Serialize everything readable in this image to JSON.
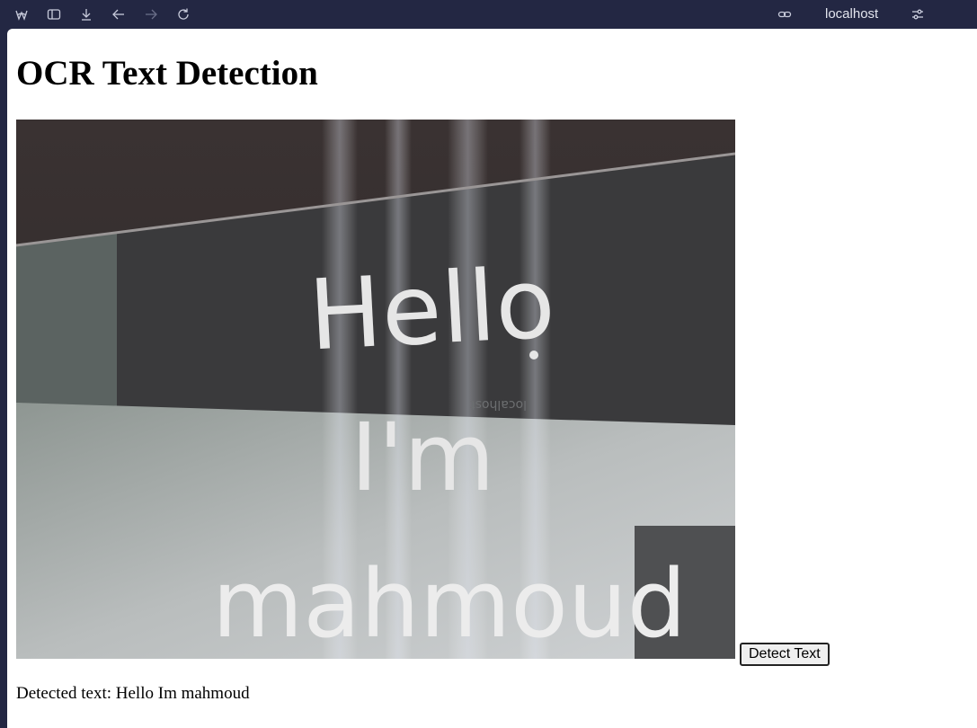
{
  "browser": {
    "url": "localhost",
    "icons": [
      "app-logo-icon",
      "sidebar-toggle-icon",
      "download-icon",
      "back-arrow-icon",
      "forward-arrow-icon",
      "reload-icon",
      "link-icon",
      "settings-sliders-icon"
    ]
  },
  "page": {
    "title": "OCR Text Detection",
    "detect_button_label": "Detect Text",
    "result_prefix": "Detected text: ",
    "result_text": "Hello Im mahmoud"
  },
  "webcam": {
    "lines": [
      "Hello",
      "I'm",
      "mahmoud"
    ],
    "background_text": "localhost"
  }
}
